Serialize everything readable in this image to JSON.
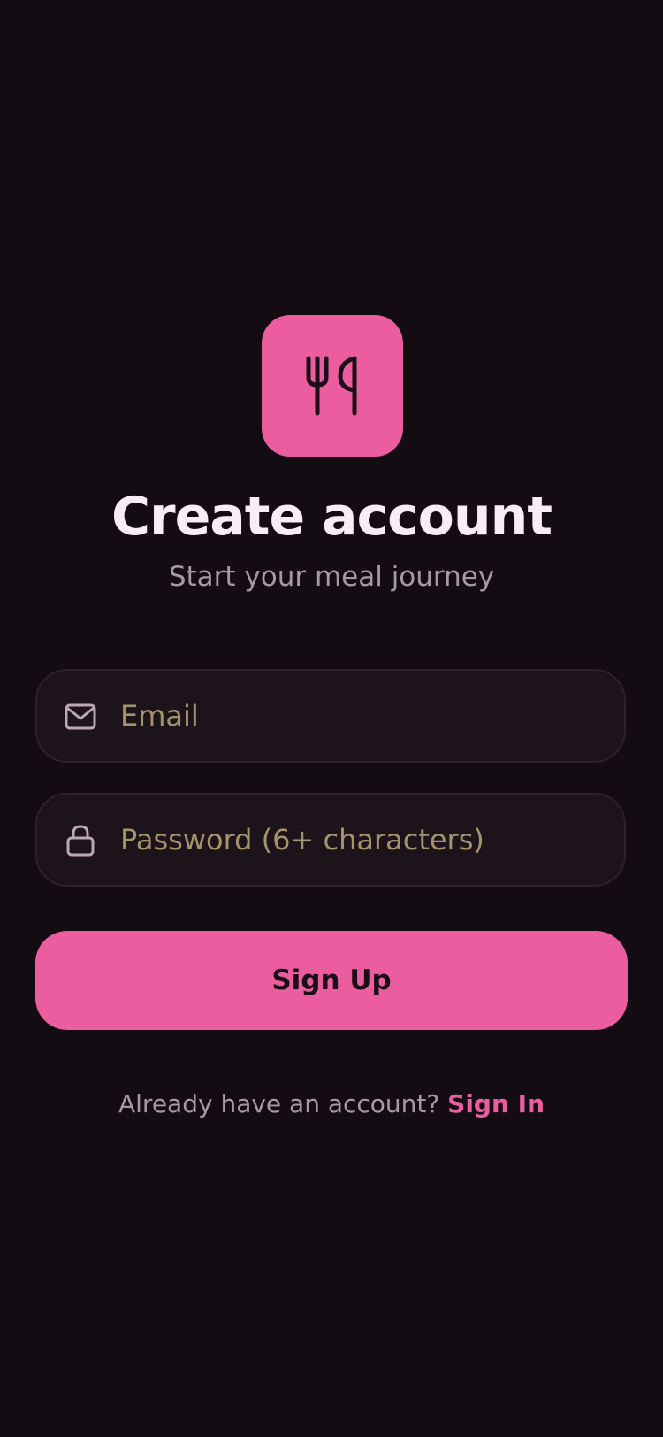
{
  "app": {
    "logo_icon": "fork-knife-icon",
    "accent_color": "#ec5da0",
    "background_color": "#130c12"
  },
  "header": {
    "title": "Create account",
    "subtitle": "Start your meal journey"
  },
  "form": {
    "email": {
      "icon": "mail-icon",
      "value": "",
      "placeholder": "Email"
    },
    "password": {
      "icon": "lock-icon",
      "value": "",
      "placeholder": "Password (6+ characters)"
    },
    "submit_label": "Sign Up"
  },
  "footer": {
    "prompt": "Already have an account?",
    "link_label": "Sign In"
  }
}
